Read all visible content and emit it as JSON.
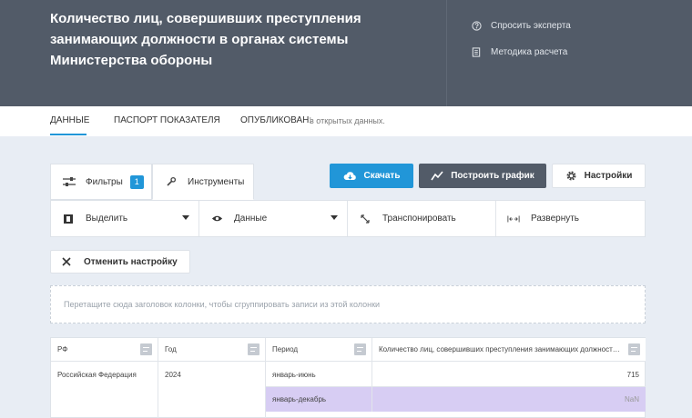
{
  "header": {
    "title": "Количество лиц, совершивших преступления занимающих должности в органах системы Министерства обороны",
    "links": [
      {
        "label": "Спросить эксперта",
        "icon": "question-circle-icon"
      },
      {
        "label": "Методика расчета",
        "icon": "document-icon"
      }
    ]
  },
  "tabs": {
    "data": "ДАННЫЕ",
    "passport": "ПАСПОРТ ПОКАЗАТЕЛЯ",
    "published_label": "ОПУБЛИКОВАН:",
    "published_value": "в открытых данных."
  },
  "toolbar": {
    "filters_label": "Фильтры",
    "filters_count": "1",
    "tools_label": "Инструменты",
    "download_label": "Скачать",
    "chart_label": "Построить график",
    "settings_label": "Настройки"
  },
  "tools": {
    "select_label": "Выделить",
    "data_label": "Данные",
    "transpose_label": "Транспонировать",
    "expand_label": "Развернуть"
  },
  "reset_label": "Отменить настройку",
  "group_hint": "Перетащите сюда заголовок колонки, чтобы сгруппировать записи из этой колонки",
  "grid": {
    "columns": [
      "РФ",
      "Год",
      "Период",
      "Количество лиц, совершивших преступления занимающих должности в органах системы Министерства обороны"
    ],
    "rows": [
      {
        "region": "Российская Федерация",
        "year": "2024",
        "period": "январь-июнь",
        "value": "715"
      },
      {
        "region": "",
        "year": "",
        "period": "январь-декабрь",
        "value": "NaN"
      }
    ]
  },
  "colors": {
    "header_bg": "#525b68",
    "accent": "#2196d8",
    "selected_row": "#d7cdf3"
  }
}
